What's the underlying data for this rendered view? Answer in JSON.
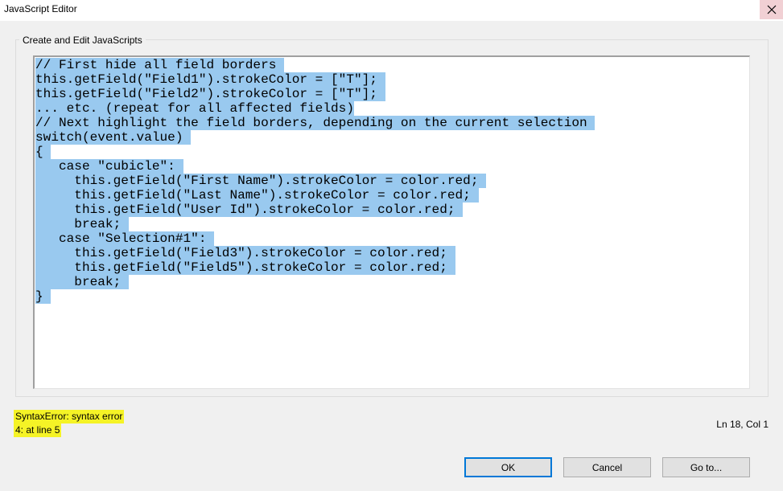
{
  "window": {
    "title": "JavaScript Editor",
    "close_icon": "close-icon"
  },
  "group": {
    "label": "Create and Edit JavaScripts"
  },
  "editor": {
    "lines": [
      "// First hide all field borders ",
      "this.getField(\"Field1\").strokeColor = [\"T\"]; ",
      "this.getField(\"Field2\").strokeColor = [\"T\"]; ",
      "... etc. (repeat for all affected fields)",
      "// Next highlight the field borders, depending on the current selection ",
      "switch(event.value) ",
      "{ ",
      "   case \"cubicle\": ",
      "     this.getField(\"First Name\").strokeColor = color.red; ",
      "     this.getField(\"Last Name\").strokeColor = color.red; ",
      "     this.getField(\"User Id\").strokeColor = color.red; ",
      "     break; ",
      "   case \"Selection#1\": ",
      "     this.getField(\"Field3\").strokeColor = color.red; ",
      "     this.getField(\"Field5\").strokeColor = color.red; ",
      "     break; ",
      "} "
    ],
    "selection_color": "#99c9ef"
  },
  "status": {
    "error_line1": "SyntaxError: syntax error",
    "error_line2": "4: at line 5",
    "cursor_position": "Ln 18, Col 1",
    "error_highlight_color": "#f5f326"
  },
  "buttons": {
    "ok": "OK",
    "cancel": "Cancel",
    "goto": "Go to..."
  }
}
